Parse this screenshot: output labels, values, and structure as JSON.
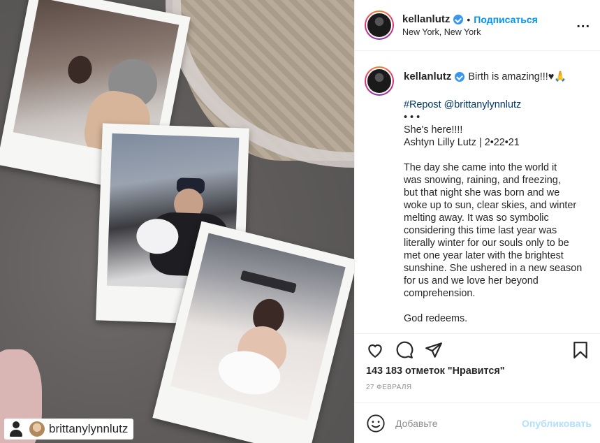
{
  "post": {
    "author": "kellanlutz",
    "location": "New York, New York",
    "follow_label": "Подписаться",
    "separator": "•",
    "more_label": "...",
    "caption": {
      "author": "kellanlutz",
      "first_line": "Birth is amazing!!!♥🙏",
      "repost": "#Repost @brittanylynnlutz",
      "dots": "• • •",
      "lines_a": [
        "She's here!!!!",
        "Ashtyn Lilly Lutz | 2•22•21"
      ],
      "paragraph": [
        "The day she came into the world it",
        "was snowing, raining, and freezing,",
        "but that night she was born and we",
        "woke up to sun, clear skies, and winter",
        "melting away. It was so symbolic",
        "considering this time last year was",
        "literally winter for our souls only to be",
        "met one year later with the brightest",
        "sunshine. She ushered in a new season",
        "for us and we love her beyond",
        "comprehension."
      ],
      "closing": "God redeems."
    },
    "likes": "143 183 отметок \"Нравится\"",
    "date": "27 ФЕВРАЛЯ",
    "comment_placeholder": "Добавьте",
    "publish_label": "Опубликовать",
    "photo_tag": "brittanylynnlutz"
  },
  "colors": {
    "link": "#0095f6",
    "hashtag": "#00376b",
    "muted": "#8e8e8e"
  },
  "icons": [
    "heart-icon",
    "comment-icon",
    "share-icon",
    "bookmark-icon",
    "emoji-icon",
    "user-tag-icon",
    "more-icon",
    "verified-icon"
  ]
}
